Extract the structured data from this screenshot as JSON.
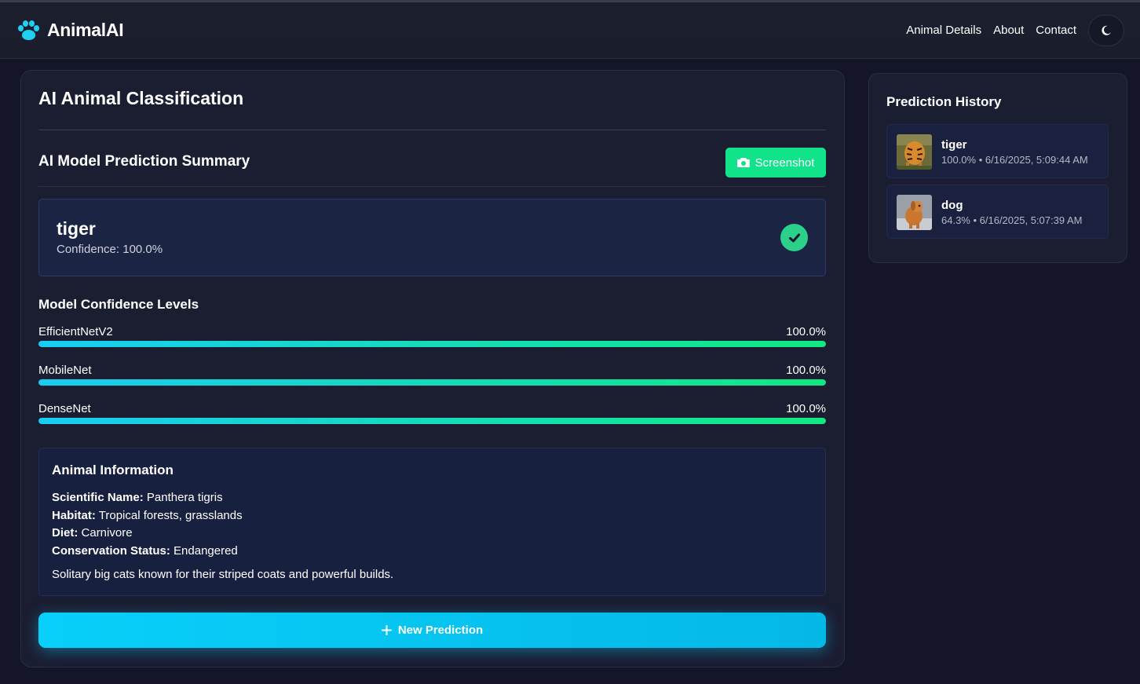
{
  "app": {
    "brand": "AnimalAI",
    "nav": [
      "Animal Details",
      "About",
      "Contact"
    ]
  },
  "main": {
    "title": "AI Animal Classification",
    "summary_title": "AI Model Prediction Summary",
    "screenshot_label": "Screenshot",
    "result": {
      "name": "tiger",
      "confidence": "Confidence: 100.0%"
    },
    "levels_title": "Model Confidence Levels",
    "levels": [
      {
        "name": "EfficientNetV2",
        "value": "100.0%",
        "fraction": 1.0
      },
      {
        "name": "MobileNet",
        "value": "100.0%",
        "fraction": 1.0
      },
      {
        "name": "DenseNet",
        "value": "100.0%",
        "fraction": 1.0
      }
    ],
    "info": {
      "title": "Animal Information",
      "scientific_label": "Scientific Name:",
      "scientific_value": "Panthera tigris",
      "habitat_label": "Habitat:",
      "habitat_value": "Tropical forests, grasslands",
      "diet_label": "Diet:",
      "diet_value": "Carnivore",
      "status_label": "Conservation Status:",
      "status_value": "Endangered",
      "description": "Solitary big cats known for their striped coats and powerful builds."
    },
    "new_prediction_label": "New Prediction"
  },
  "history": {
    "title": "Prediction History",
    "items": [
      {
        "name": "tiger",
        "meta": "100.0% • 6/16/2025, 5:09:44 AM"
      },
      {
        "name": "dog",
        "meta": "64.3% • 6/16/2025, 5:07:39 AM"
      }
    ]
  },
  "colors": {
    "accent": "#1fd0f2",
    "success": "#10e38a",
    "background": "#141627"
  }
}
